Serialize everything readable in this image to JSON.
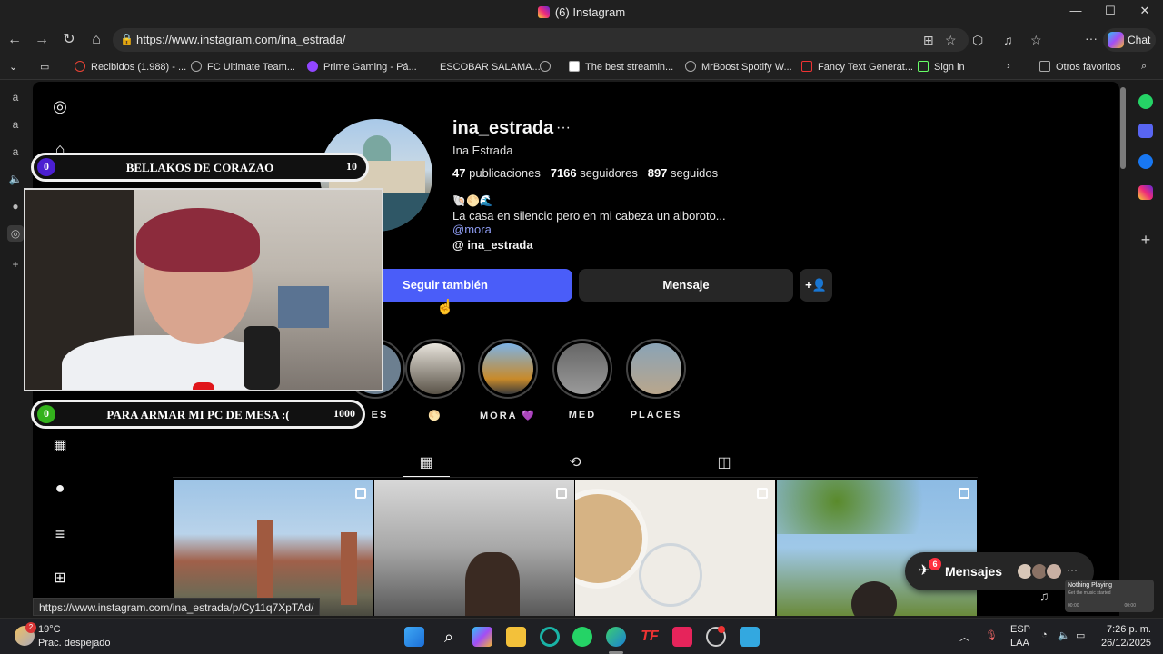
{
  "window": {
    "title": "(6) Instagram"
  },
  "browser": {
    "url": "https://www.instagram.com/ina_estrada/",
    "chat_label": "Chat",
    "bookmarks": [
      {
        "label": "Recibidos (1.988) - ..."
      },
      {
        "label": "FC Ultimate Team..."
      },
      {
        "label": "Prime Gaming - Pá..."
      },
      {
        "label": "ESCOBAR SALAMA..."
      },
      {
        "label": "The best streamin..."
      },
      {
        "label": "MrBoost Spotify W..."
      },
      {
        "label": "Fancy Text Generat..."
      },
      {
        "label": "Sign in"
      }
    ],
    "other_favorites": "Otros favoritos",
    "status_url": "https://www.instagram.com/ina_estrada/p/Cy11q7XpTAd/"
  },
  "profile": {
    "username": "ina_estrada",
    "more": "···",
    "full_name": "Ina Estrada",
    "posts_count": "47",
    "posts_label": "publicaciones",
    "followers_count": "7166",
    "followers_label": "seguidores",
    "following_count": "897",
    "following_label": "seguidos",
    "emojis": "🐚🌕🌊",
    "bio": "La casa en silencio pero en mi cabeza un alboroto...",
    "mention": "@mora",
    "threads_handle": "ina_estrada",
    "follow_button": "Seguir también",
    "message_button": "Mensaje",
    "add_user_icon": "add-person-icon"
  },
  "highlights": [
    {
      "label": "ES"
    },
    {
      "label": "🌕"
    },
    {
      "label": "MORA 💜"
    },
    {
      "label": "MED"
    },
    {
      "label": "PLACES"
    }
  ],
  "tabs": [
    "grid-icon",
    "reels-icon",
    "tagged-icon"
  ],
  "overlay": {
    "top_bar": {
      "left": "0",
      "label": "BELLAKOS DE CORAZAO",
      "right": "10"
    },
    "bottom_bar": {
      "left": "0",
      "label": "PARA ARMAR MI PC DE MESA :(",
      "right": "1000"
    }
  },
  "messages": {
    "label": "Mensajes",
    "badge": "6",
    "more": "···"
  },
  "now_playing": {
    "title": "Nothing Playing",
    "subtitle": "Get the music started",
    "start": "00:00",
    "end": "00:00"
  },
  "taskbar": {
    "weather_temp": "19°C",
    "weather_desc": "Prac. despejado",
    "weather_badge": "2",
    "lang1": "ESP",
    "lang2": "LAA",
    "time": "7:26 p. m.",
    "date": "26/12/2025"
  },
  "colors": {
    "accent": "#4a5df9",
    "page_bg": "#000000",
    "badge": "#ff3040"
  }
}
